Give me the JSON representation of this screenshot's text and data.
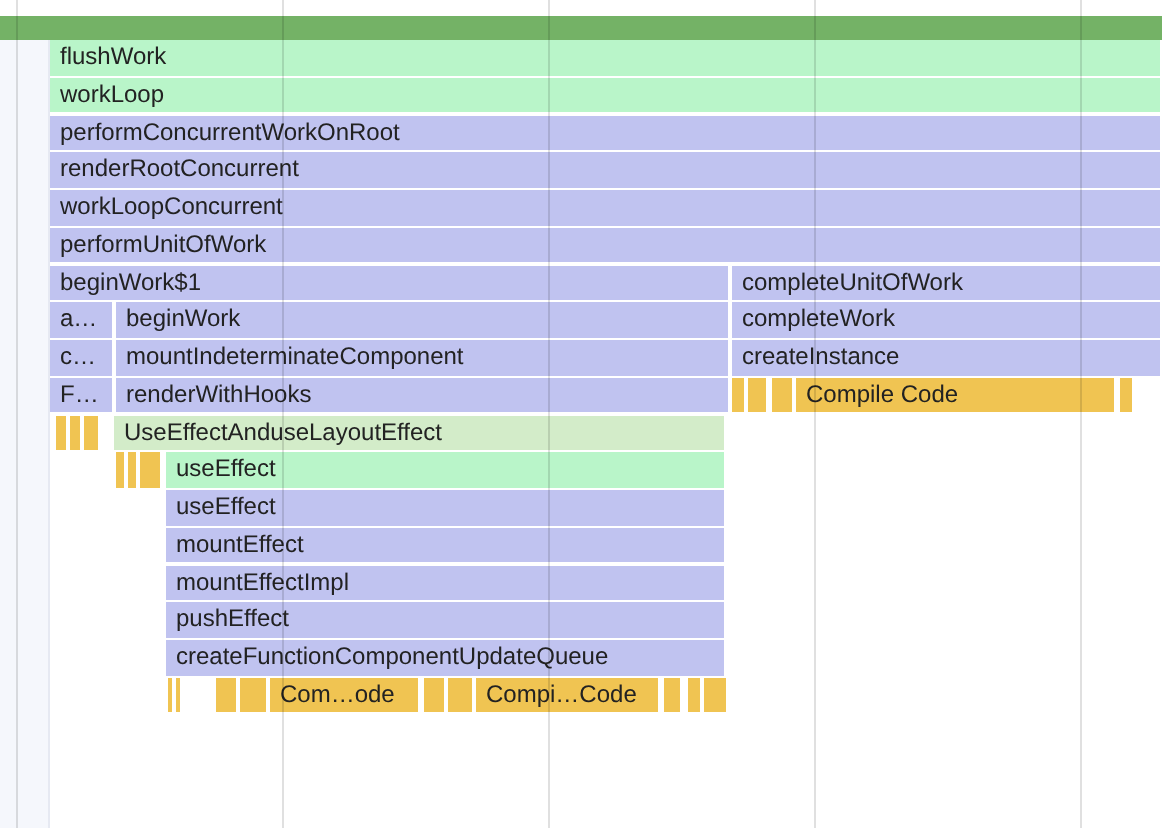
{
  "flame_chart": {
    "frames": [
      {
        "label": "flushWork",
        "kind": "green"
      },
      {
        "label": "workLoop",
        "kind": "green"
      },
      {
        "label": "performConcurrentWorkOnRoot",
        "kind": "purple"
      },
      {
        "label": "renderRootConcurrent",
        "kind": "purple"
      },
      {
        "label": "workLoopConcurrent",
        "kind": "purple"
      },
      {
        "label": "performUnitOfWork",
        "kind": "purple"
      },
      {
        "label": "beginWork$1",
        "kind": "purple"
      },
      {
        "label": "completeUnitOfWork",
        "kind": "purple"
      },
      {
        "label": "a…",
        "kind": "purple"
      },
      {
        "label": "beginWork",
        "kind": "purple"
      },
      {
        "label": "completeWork",
        "kind": "purple"
      },
      {
        "label": "c…",
        "kind": "purple"
      },
      {
        "label": "mountIndeterminateComponent",
        "kind": "purple"
      },
      {
        "label": "createInstance",
        "kind": "purple"
      },
      {
        "label": "F…",
        "kind": "purple"
      },
      {
        "label": "renderWithHooks",
        "kind": "purple"
      },
      {
        "label": "Compile Code",
        "kind": "yellow"
      },
      {
        "label": "UseEffectAnduseLayoutEffect",
        "kind": "pale-green"
      },
      {
        "label": "useEffect",
        "kind": "green"
      },
      {
        "label": "useEffect",
        "kind": "purple"
      },
      {
        "label": "mountEffect",
        "kind": "purple"
      },
      {
        "label": "mountEffectImpl",
        "kind": "purple"
      },
      {
        "label": "pushEffect",
        "kind": "purple"
      },
      {
        "label": "createFunctionComponentUpdateQueue",
        "kind": "purple"
      },
      {
        "label": "Com…ode",
        "kind": "yellow"
      },
      {
        "label": "Compi…Code",
        "kind": "yellow"
      }
    ]
  }
}
